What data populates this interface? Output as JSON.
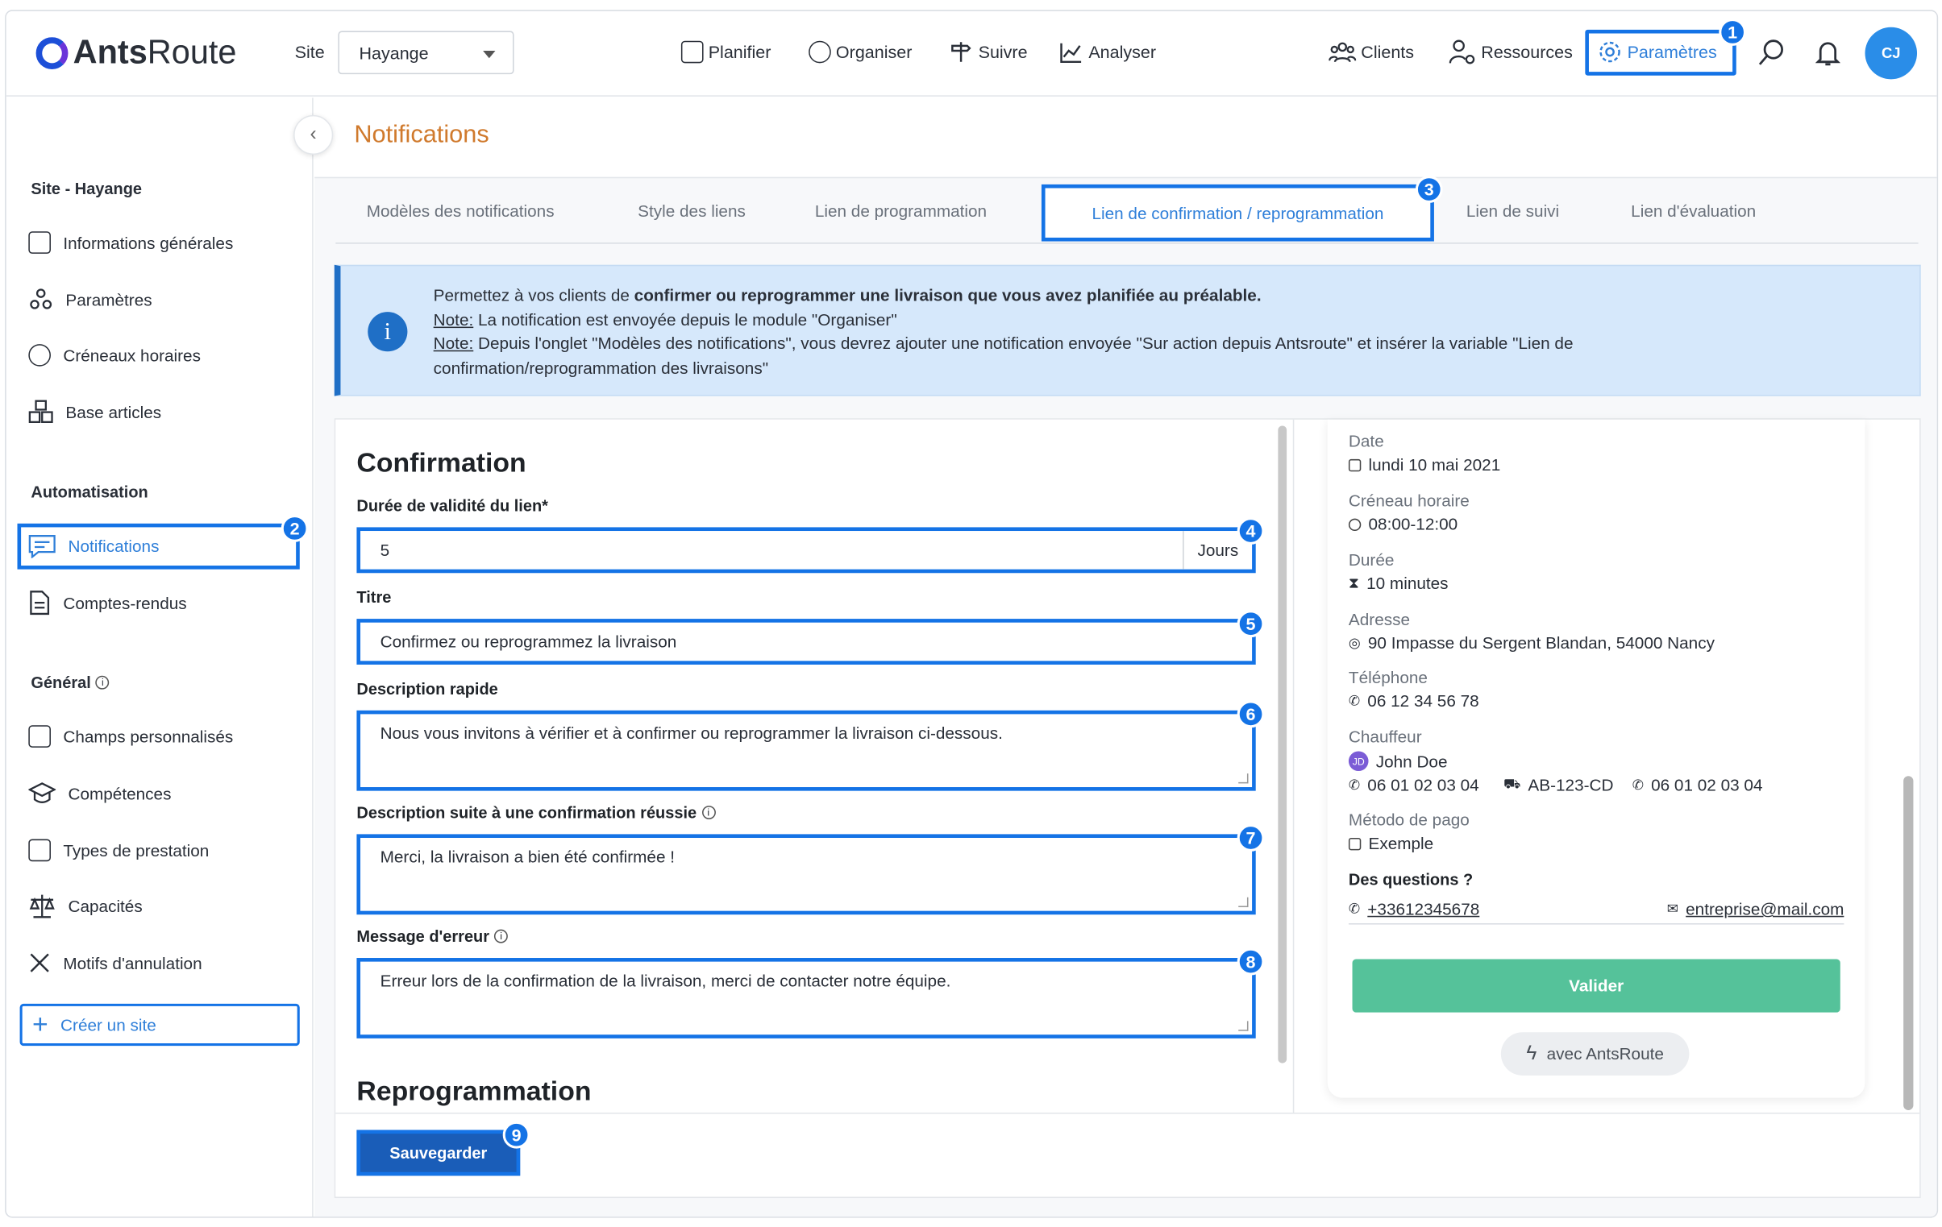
{
  "brand": {
    "name_bold": "Ants",
    "name_rest": "Route"
  },
  "site_selector": {
    "label": "Site",
    "value": "Hayange"
  },
  "nav": [
    {
      "label": "Planifier",
      "icon": "calendar-icon"
    },
    {
      "label": "Organiser",
      "icon": "gauge-icon"
    },
    {
      "label": "Suivre",
      "icon": "signpost-icon"
    },
    {
      "label": "Analyser",
      "icon": "chart-icon"
    }
  ],
  "right_nav": {
    "clients": "Clients",
    "ressources": "Ressources",
    "parametres": "Paramètres",
    "avatar": "CJ"
  },
  "badges": [
    "1",
    "2",
    "3",
    "4",
    "5",
    "6",
    "7",
    "8",
    "9"
  ],
  "sidebar": {
    "site_title": "Site - Hayange",
    "site_items": [
      "Informations générales",
      "Paramètres",
      "Créneaux horaires",
      "Base articles"
    ],
    "auto_title": "Automatisation",
    "auto_items": [
      "Notifications",
      "Comptes-rendus"
    ],
    "general_title": "Général",
    "general_items": [
      "Champs personnalisés",
      "Compétences",
      "Types de prestation",
      "Capacités",
      "Motifs d'annulation"
    ],
    "create_site": "Créer un site"
  },
  "page_title": "Notifications",
  "tabs": [
    "Modèles des notifications",
    "Style des liens",
    "Lien de programmation",
    "Lien de confirmation / reprogrammation",
    "Lien de suivi",
    "Lien d'évaluation"
  ],
  "info": {
    "line1_pre": "Permettez à vos clients de ",
    "line1_bold": "confirmer ou reprogrammer une livraison que vous avez planifiée au préalable.",
    "note_label": "Note:",
    "note1": " La notification est envoyée depuis le module \"Organiser\"",
    "note2": " Depuis l'onglet \"Modèles des notifications\", vous devrez ajouter une notification envoyée \"Sur action depuis Antsroute\" et insérer la variable \"Lien de confirmation/reprogrammation des livraisons\""
  },
  "form": {
    "section1": "Confirmation",
    "validity_label": "Durée de validité du lien*",
    "validity_value": "5",
    "validity_unit": "Jours",
    "title_label": "Titre",
    "title_value": "Confirmez ou reprogrammez la livraison",
    "desc_label": "Description rapide",
    "desc_value": "Nous vous invitons à vérifier et à confirmer ou reprogrammer la livraison ci-dessous.",
    "success_label": "Description suite à une confirmation réussie",
    "success_value": "Merci, la livraison a bien été confirmée !",
    "error_label": "Message d'erreur",
    "error_value": "Erreur lors de la confirmation de la livraison, merci de contacter notre équipe.",
    "section2": "Reprogrammation",
    "save": "Sauvegarder"
  },
  "preview": {
    "date_label": "Date",
    "date_value": "lundi 10 mai 2021",
    "slot_label": "Créneau horaire",
    "slot_value": "08:00-12:00",
    "duration_label": "Durée",
    "duration_value": "10 minutes",
    "address_label": "Adresse",
    "address_value": "90 Impasse du Sergent Blandan, 54000 Nancy",
    "phone_label": "Téléphone",
    "phone_value": "06 12 34 56 78",
    "driver_label": "Chauffeur",
    "driver_initials": "JD",
    "driver_name": "John Doe",
    "driver_phone": "06 01 02 03 04",
    "driver_plate": "AB-123-CD",
    "driver_phone2": "06 01 02 03 04",
    "pay_label": "Método de pago",
    "pay_value": "Exemple",
    "questions_label": "Des questions ?",
    "contact_phone": "+33612345678",
    "contact_email": "entreprise@mail.com",
    "validate": "Valider",
    "powered": "avec AntsRoute"
  },
  "colors": {
    "accent": "#1473e6",
    "title_orange": "#d07a2d",
    "valider_green": "#55c29a"
  }
}
